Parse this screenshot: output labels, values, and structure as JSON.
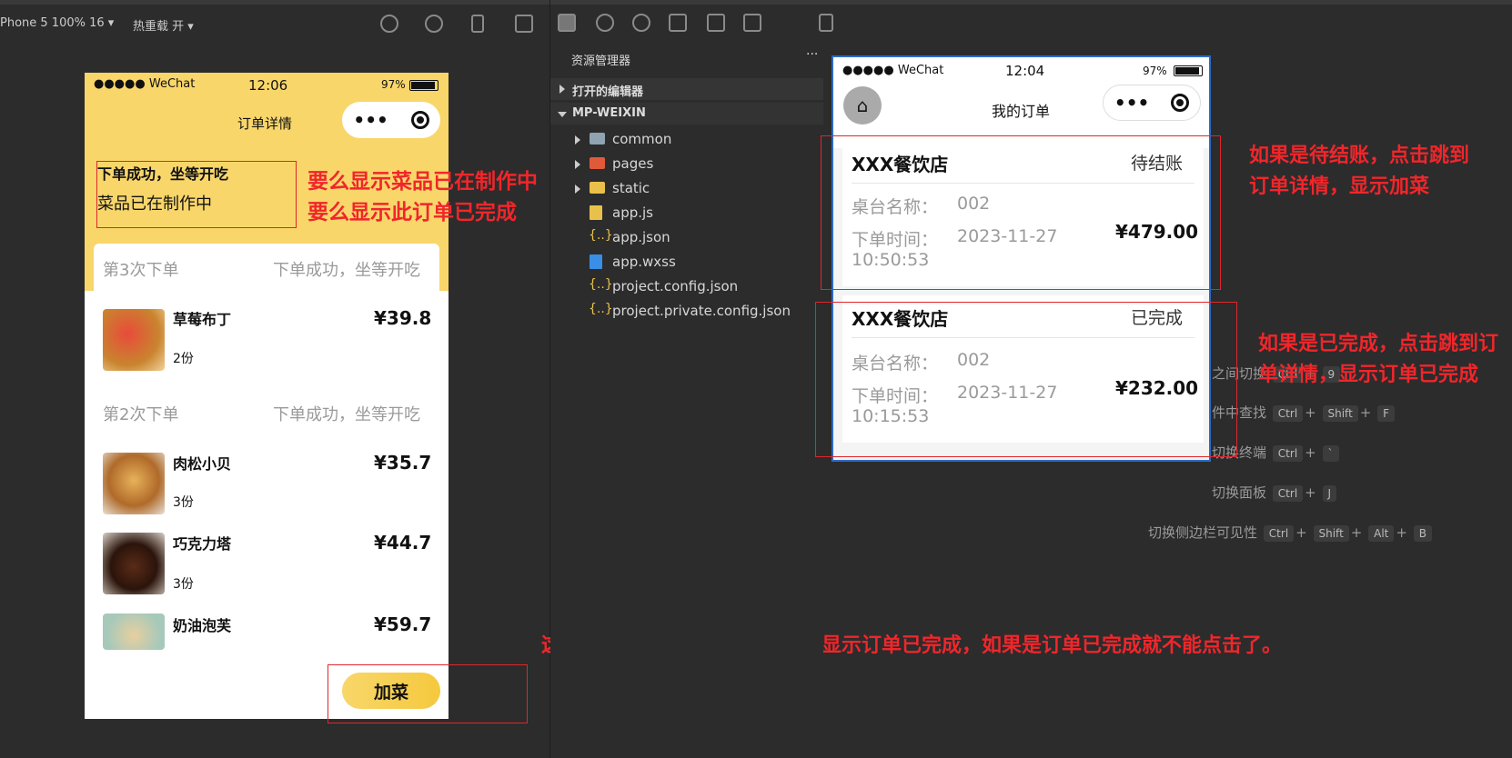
{
  "toolbar": {
    "device": "Phone 5 100% 16 ▾",
    "hot_reload": "热重载 开 ▾"
  },
  "left_phone": {
    "status": {
      "carrier": "●●●●● WeChat",
      "time": "12:06",
      "battery": "97%"
    },
    "nav_title": "订单详情",
    "capsule_dots": "•••",
    "status_box": {
      "line1": "下单成功，坐等开吃",
      "line2": "菜品已在制作中"
    },
    "groups": [
      {
        "title": "第3次下单",
        "status": "下单成功，坐等开吃"
      },
      {
        "title": "第2次下单",
        "status": "下单成功，坐等开吃"
      }
    ],
    "dishes": [
      {
        "name": "草莓布丁",
        "price": "¥39.8",
        "qty": "2份"
      },
      {
        "name": "肉松小贝",
        "price": "¥35.7",
        "qty": "3份"
      },
      {
        "name": "巧克力塔",
        "price": "¥44.7",
        "qty": "3份"
      },
      {
        "name": "奶油泡芙",
        "price": "¥59.7",
        "qty": ""
      }
    ],
    "add_button": "加菜"
  },
  "annotations": {
    "status_note_1": "要么显示菜品已在制作中",
    "status_note_2": "要么显示此订单已完成",
    "bottom_note": "这个地方，要么显示加菜，要么显示订单已完成，如果是订单已完成就不能点击了。",
    "pending_note": "如果是待结账，点击跳到订单详情，显示加菜",
    "done_note": "如果是已完成，点击跳到订单详情，显示订单已完成"
  },
  "explorer": {
    "title": "资源管理器",
    "more": "···",
    "open_editors": "打开的编辑器",
    "project": "MP-WEIXIN",
    "items": [
      {
        "name": "common",
        "icon": "folder-icon"
      },
      {
        "name": "pages",
        "icon": "folder-icon"
      },
      {
        "name": "static",
        "icon": "folder-icon"
      },
      {
        "name": "app.js",
        "icon": "js-file-icon"
      },
      {
        "name": "app.json",
        "icon": "json-file-icon"
      },
      {
        "name": "app.wxss",
        "icon": "css-file-icon"
      },
      {
        "name": "project.config.json",
        "icon": "json-file-icon"
      },
      {
        "name": "project.private.config.json",
        "icon": "json-file-icon"
      }
    ]
  },
  "right_phone": {
    "status": {
      "carrier": "●●●●● WeChat",
      "time": "12:04",
      "battery": "97%"
    },
    "nav_title": "我的订单",
    "capsule_dots": "•••",
    "orders": [
      {
        "shop": "XXX餐饮店",
        "state": "待结账",
        "table_label": "桌台名称：",
        "table": "002",
        "time_label": "下单时间：",
        "date": "2023-11-27",
        "time": "10:50:53",
        "amount": "¥479.00"
      },
      {
        "shop": "XXX餐饮店",
        "state": "已完成",
        "table_label": "桌台名称：",
        "table": "002",
        "time_label": "下单时间：",
        "date": "2023-11-27",
        "time": "10:15:53",
        "amount": "¥232.00"
      }
    ]
  },
  "shortcuts": [
    {
      "label": "之间切换",
      "keys": [
        "Ctrl",
        "9"
      ]
    },
    {
      "label": "件中查找",
      "keys": [
        "Ctrl",
        "Shift",
        "F"
      ]
    },
    {
      "label": "切换终端",
      "keys": [
        "Ctrl",
        "`"
      ]
    },
    {
      "label": "切换面板",
      "keys": [
        "Ctrl",
        "J"
      ]
    },
    {
      "label": "切换侧边栏可见性",
      "keys": [
        "Ctrl",
        "Shift",
        "Alt",
        "B"
      ]
    }
  ],
  "colors": {
    "brand_yellow": "#f8d66a",
    "annotation_red": "#f0262b",
    "accent_blue": "#2d6bc4"
  }
}
